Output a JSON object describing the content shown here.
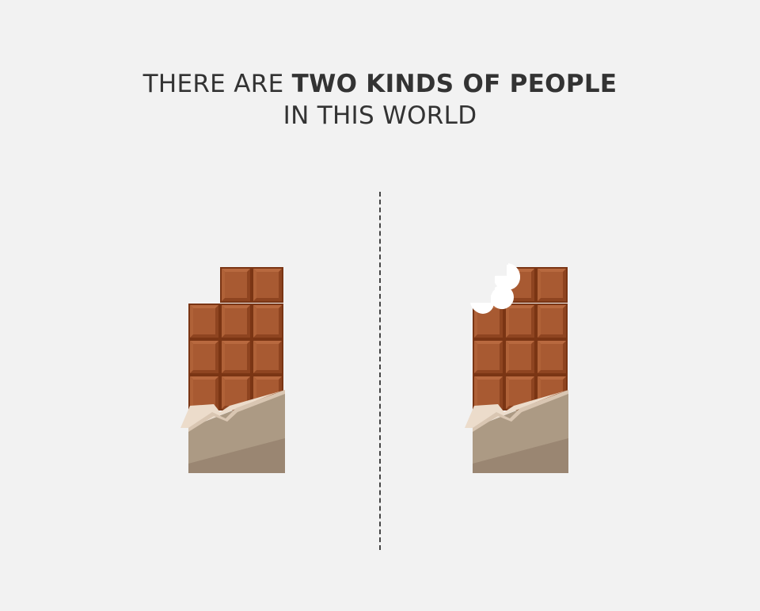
{
  "title": {
    "line1_regular": "THERE ARE ",
    "line1_bold": "TWO KINDS OF PEOPLE",
    "line2": "IN THIS WORLD"
  },
  "illustrations": [
    {
      "id": "left",
      "description_icon": "chocolate-bar-icon",
      "state": "broken-corner"
    },
    {
      "id": "right",
      "description_icon": "chocolate-bar-icon",
      "state": "bitten-corner"
    }
  ],
  "colors": {
    "background": "#f2f2f2",
    "chocolate": "#a0522d",
    "chocolate_dark": "#7a3514",
    "chocolate_light": "#b8693f",
    "foil": "#ecdccb",
    "wrapper_light": "#ac9a84",
    "wrapper_dark": "#9a8672",
    "text": "#333333"
  }
}
